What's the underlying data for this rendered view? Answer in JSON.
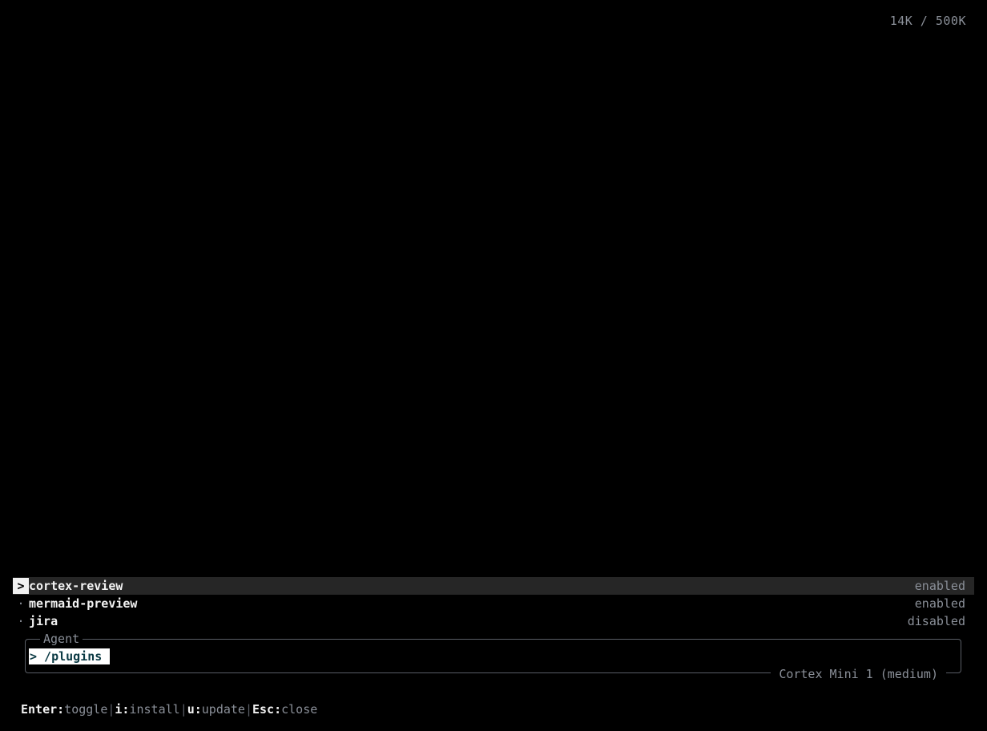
{
  "header": {
    "token_usage": "14K / 500K"
  },
  "plugins": {
    "selected_marker": ">",
    "unselected_marker": "·",
    "items": [
      {
        "name": "cortex-review",
        "status": "enabled"
      },
      {
        "name": "mermaid-preview",
        "status": "enabled"
      },
      {
        "name": "jira",
        "status": "disabled"
      }
    ]
  },
  "agent": {
    "label": "Agent",
    "input_value": "> /plugins",
    "model": "Cortex Mini 1 (medium)"
  },
  "hints": {
    "items": [
      {
        "key": "Enter:",
        "desc": "toggle"
      },
      {
        "key": "i:",
        "desc": "install"
      },
      {
        "key": "u:",
        "desc": "update"
      },
      {
        "key": "Esc:",
        "desc": "close"
      }
    ],
    "separator": "|"
  },
  "colors": {
    "background": "#000000",
    "selected_row": "#262626",
    "muted_text": "#8a8f98",
    "bright_text": "#f2f2f2",
    "input_text": "#0b3a44"
  }
}
